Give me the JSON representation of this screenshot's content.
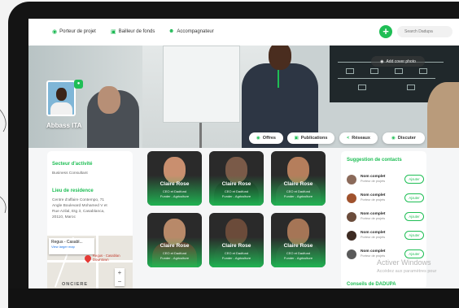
{
  "nav": {
    "items": [
      {
        "label": "Porteur de projet",
        "icon": "lightbulb-icon"
      },
      {
        "label": "Bailleur de fonds",
        "icon": "briefcase-icon"
      },
      {
        "label": "Accompagnateur",
        "icon": "people-icon"
      }
    ],
    "plus_label": "+",
    "search_placeholder": "Search Dadupa"
  },
  "banner": {
    "add_cover_label": "Add cover photo",
    "profile_name": "Abbass ITA",
    "actions": [
      {
        "label": "Offres",
        "icon": "offers-icon"
      },
      {
        "label": "Publications",
        "icon": "publications-icon"
      },
      {
        "label": "Réseaux",
        "icon": "share-icon"
      },
      {
        "label": "Discuter",
        "icon": "chat-icon"
      }
    ]
  },
  "about": {
    "sector_title": "Secteur d'activité",
    "sector_value": "Business Consultant",
    "residence_title": "Lieu de residence",
    "residence_lines": [
      "Centre d'affaire Contempo, 71",
      "Angle Boulevard Mohamed V et",
      "Rue Azilal, Etg 3, Casablanca,",
      "20110, Maroc"
    ],
    "map": {
      "popup_title": "Regus - Casabl...",
      "popup_link": "View larger map",
      "pin_label_1": "Regus - Casablan",
      "pin_label_2": "Downtown",
      "area_text": "ONCIERE",
      "zoom_in": "+",
      "zoom_out": "−"
    }
  },
  "cards": [
    {
      "name": "Claire Rose",
      "role1": "CEO et Dadfund",
      "role2": "Funder - Agriculture",
      "skin": "#c98f6f",
      "shirt": "#2b2b2b"
    },
    {
      "name": "Claire Rose",
      "role1": "CEO et Dadfund",
      "role2": "Funder - Agriculture",
      "skin": "#7a5a48",
      "shirt": "#1d1d1d"
    },
    {
      "name": "Claire Rose",
      "role1": "CEO et Dadfund",
      "role2": "Funder - Agriculture",
      "skin": "#b57e5c",
      "shirt": "#3a3a3a"
    },
    {
      "name": "Claire Rose",
      "role1": "CEO et Dadfund",
      "role2": "Funder - Agriculture",
      "skin": "#b88969",
      "shirt": "#6d2b2b"
    },
    {
      "name": "Claire Rose",
      "role1": "CEO et Dadfund",
      "role2": "Funder - Agriculture",
      "skin": "#6b4b3a",
      "shirt": "#2e2e2e"
    },
    {
      "name": "Claire Rose",
      "role1": "CEO et Dadfund",
      "role2": "Funder - Agriculture",
      "skin": "#a57556",
      "shirt": "#333333"
    }
  ],
  "suggestions": {
    "title": "Suggestion de contacts",
    "contacts": [
      {
        "name": "Nom complet",
        "role": "Porteur de projets",
        "button": "Ajouter",
        "avatar": "#8b6a5a"
      },
      {
        "name": "Nom complet",
        "role": "Porteur de projets",
        "button": "Ajouter",
        "avatar": "#a0522d"
      },
      {
        "name": "Nom complet",
        "role": "Porteur de projets",
        "button": "Ajouter",
        "avatar": "#6b4c3b"
      },
      {
        "name": "Nom complet",
        "role": "Porteur de projets",
        "button": "Ajouter",
        "avatar": "#3d2b22"
      },
      {
        "name": "Nom complet",
        "role": "Porteur de projets",
        "button": "Ajouter",
        "avatar": "#5a5a5a"
      }
    ],
    "conseils_title": "Conseils de DADUPA"
  },
  "watermark": {
    "line1": "Activer Windows",
    "line2": "Accédez aux paramètres pour"
  },
  "colors": {
    "accent": "#1fbe55",
    "frame": "#141414"
  }
}
